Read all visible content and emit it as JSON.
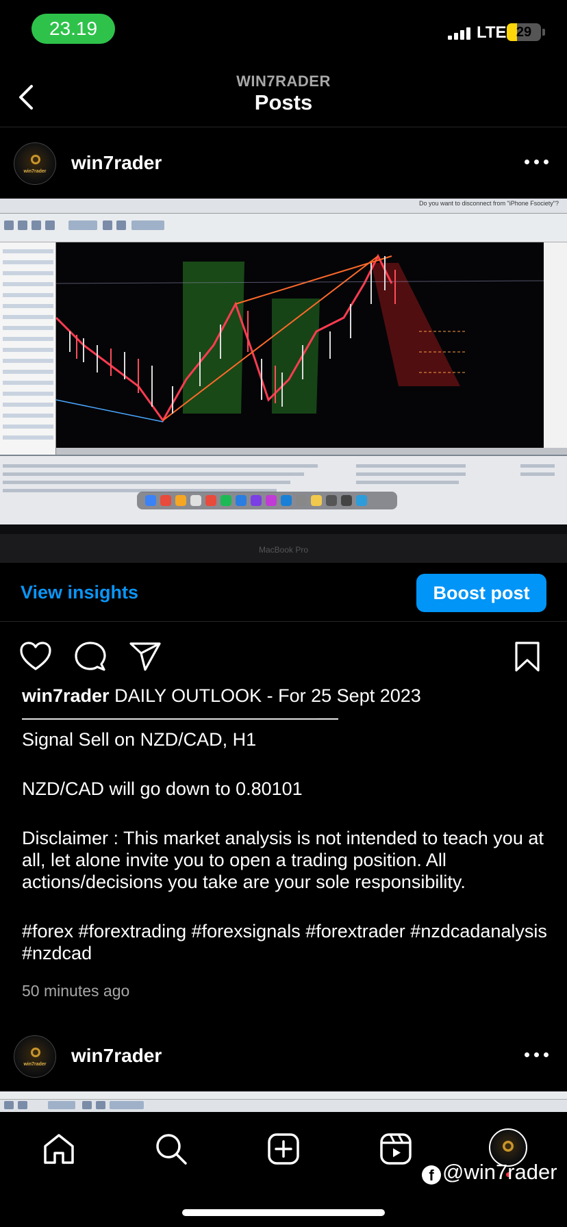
{
  "status_bar": {
    "time": "23.19",
    "network": "LTE",
    "battery": "29",
    "battery_level": 0.29
  },
  "header": {
    "subtitle": "WIN7RADER",
    "title": "Posts"
  },
  "post": {
    "username": "win7rader",
    "photo_texts": {
      "disconnect_prompt": "Do you want to disconnect from \"iPhone Fsociety\"?",
      "laptop_label": "MacBook Pro"
    },
    "insights_label": "View insights",
    "boost_label": "Boost post",
    "caption_title": "DAILY OUTLOOK - For 25 Sept 2023",
    "caption_rule": "————————————————––",
    "signal": "Signal Sell on NZD/CAD, H1",
    "target": "NZD/CAD will go down to 0.80101",
    "disclaimer": "Disclaimer : This market analysis is not intended to teach you at all, let alone invite you to open a trading position. All actions/decisions you take are your sole responsibility.",
    "hashtags": "#forex #forextrading #forexsignals #forextrader #nzdcadanalysis #nzdcad",
    "time_ago": "50 minutes ago"
  },
  "next_post": {
    "username": "win7rader"
  },
  "icons": {
    "back": "chevron-left-icon",
    "more": "more-horizontal-icon",
    "like": "heart-icon",
    "comment": "comment-icon",
    "share": "paper-plane-icon",
    "save": "bookmark-icon",
    "home": "home-icon",
    "search": "search-icon",
    "create": "plus-square-icon",
    "reels": "reels-icon",
    "profile": "profile-avatar-icon"
  },
  "watermark": "@win7rader",
  "colors": {
    "accent": "#0095f6",
    "link": "#0a95f6",
    "time_pill": "#2fc24b",
    "battery": "#ffd60a"
  }
}
